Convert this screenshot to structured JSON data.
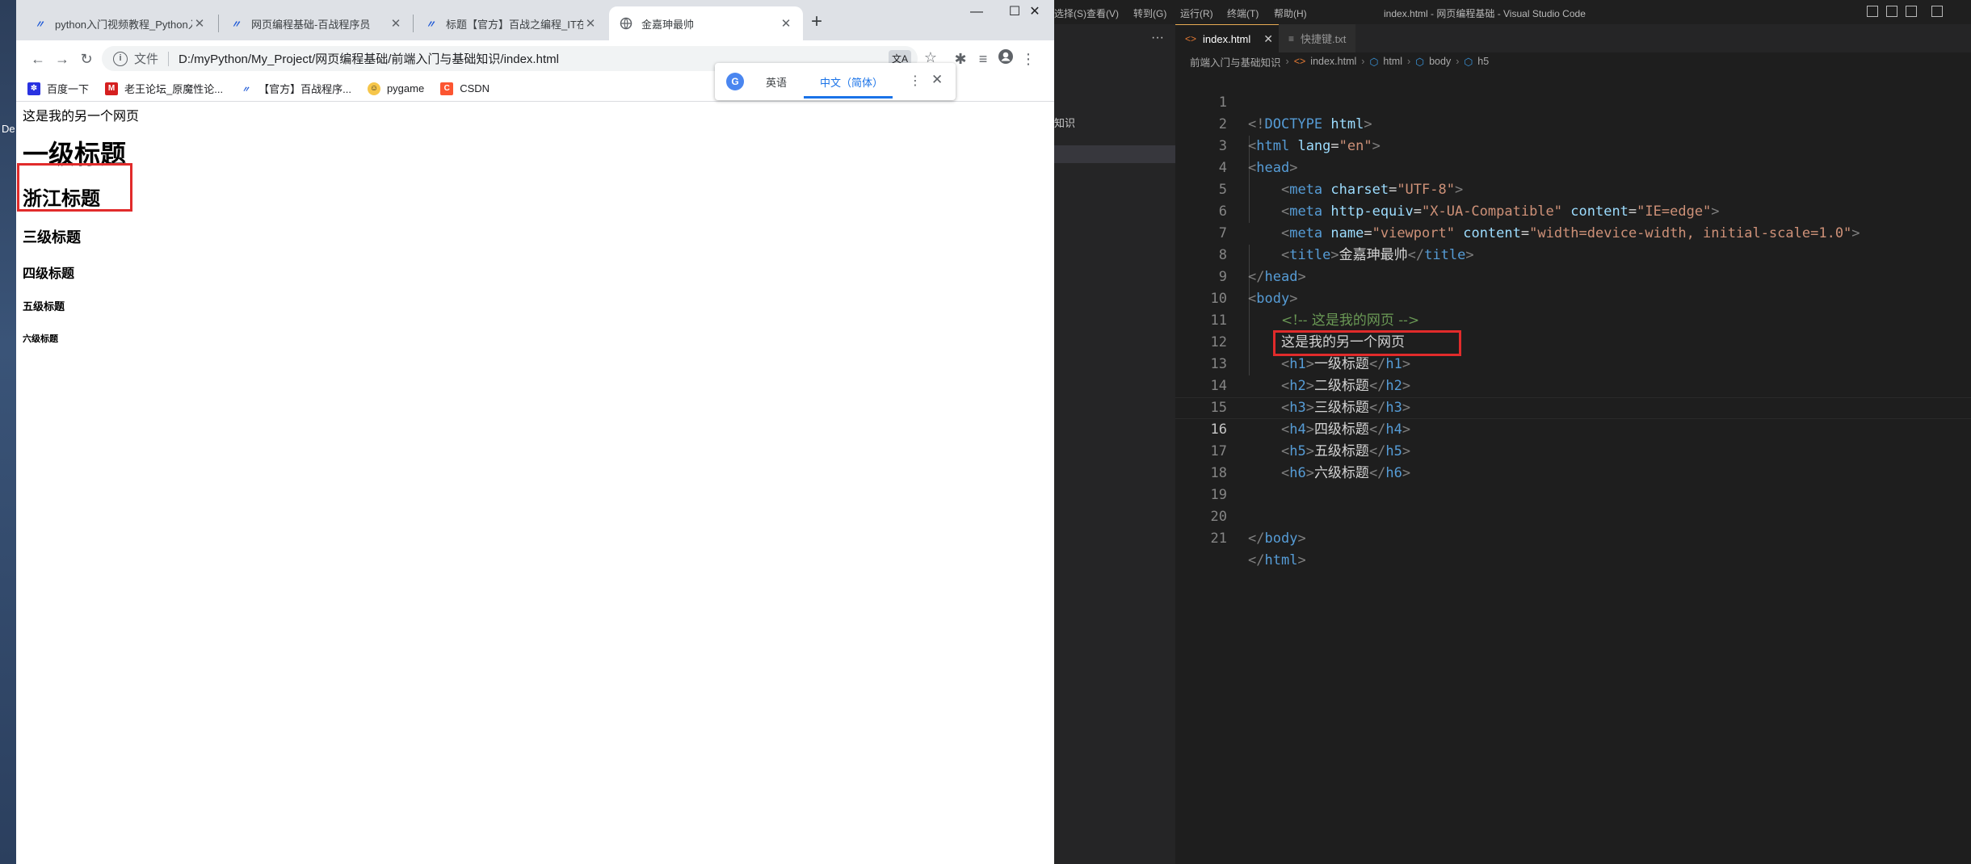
{
  "desktop": {
    "label": "De"
  },
  "chrome": {
    "tabs": [
      {
        "icon": "baizhan-icon",
        "title": "python入门视频教程_Python入"
      },
      {
        "icon": "baizhan-icon",
        "title": "网页编程基础-百战程序员"
      },
      {
        "icon": "baizhan-icon",
        "title": "标题【官方】百战之编程_IT在线"
      },
      {
        "icon": "globe-icon",
        "title": "金嘉珅最帅"
      }
    ],
    "window_controls": [
      "—",
      "☐",
      "✕"
    ],
    "address": {
      "scheme": "文件",
      "url": "D:/myPython/My_Project/网页编程基础/前端入门与基础知识/index.html"
    },
    "bookmarks": [
      {
        "label": "百度一下",
        "icon": "baidu-icon"
      },
      {
        "label": "老王论坛_原魔性论...",
        "icon": "laowang-icon"
      },
      {
        "label": "【官方】百战程序...",
        "icon": "baizhan-icon"
      },
      {
        "label": "pygame",
        "icon": "pygame-icon"
      },
      {
        "label": "CSDN",
        "icon": "csdn-icon"
      }
    ],
    "translate": {
      "lang_from": "英语",
      "lang_to": "中文（简体）"
    },
    "page": {
      "p": "这是我的另一个网页",
      "h1": "一级标题",
      "h2": "浙江标题",
      "h3": "三级标题",
      "h4": "四级标题",
      "h5": "五级标题",
      "h6": "六级标题"
    }
  },
  "vscode": {
    "menu": [
      "选择(S)",
      "查看(V)",
      "转到(G)",
      "运行(R)",
      "终端(T)",
      "帮助(H)"
    ],
    "window_title": "index.html - 网页编程基础 - Visual Studio Code",
    "sidebar_label": "知识",
    "tabs": [
      {
        "label": "index.html",
        "active": true
      },
      {
        "label": "快捷键.txt",
        "active": false
      }
    ],
    "breadcrumbs": [
      "前端入门与基础知识",
      "index.html",
      "html",
      "body",
      "h5"
    ],
    "current_line": 16,
    "lines": [
      "1",
      "2",
      "3",
      "4",
      "5",
      "6",
      "7",
      "8",
      "9",
      "10",
      "11",
      "12",
      "13",
      "14",
      "15",
      "16",
      "17",
      "18",
      "19",
      "20",
      "21"
    ],
    "code": {
      "doctype": "DOCTYPE",
      "html": "html",
      "lang_attr": "lang",
      "lang_val": "\"en\"",
      "head": "head",
      "meta": "meta",
      "charset": "charset",
      "charset_val": "\"UTF-8\"",
      "http_equiv": "http-equiv",
      "http_equiv_val": "\"X-UA-Compatible\"",
      "content": "content",
      "content_val1": "\"IE=edge\"",
      "name": "name",
      "name_val": "\"viewport\"",
      "content_val2": "\"width=device-width, initial-scale=1.0\"",
      "title": "title",
      "title_text": "金嘉珅最帅",
      "body": "body",
      "comment": "<!-- 这是我的网页 -->",
      "p_text": "这是我的另一个网页",
      "h1_text": "一级标题",
      "h2_text": "二级标题",
      "h3_text": "三级标题",
      "h4_text": "四级标题",
      "h5_text": "五级标题",
      "h6_text": "六级标题",
      "h1": "h1",
      "h2": "h2",
      "h3": "h3",
      "h4": "h4",
      "h5": "h5",
      "h6": "h6"
    }
  }
}
